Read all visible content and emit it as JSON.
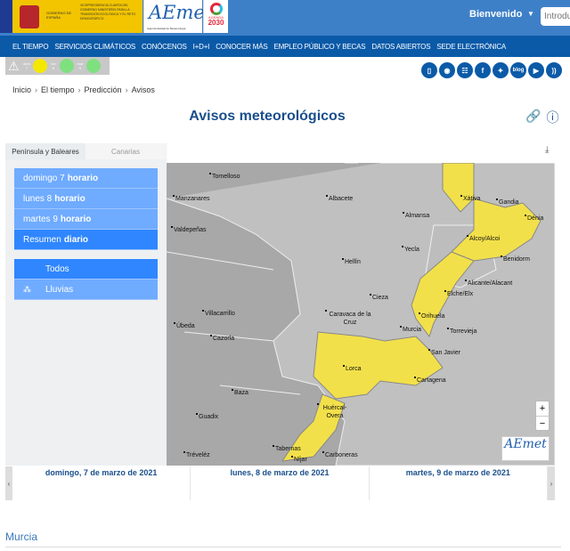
{
  "header": {
    "gov_label": "GOBIERNO DE ESPAÑA",
    "ministry": "VICEPRESIDENCIA CUARTA DEL GOBIERNO MINISTERIO PARA LA TRANSICIÓN ECOLÓGICA Y EL RETO DEMOGRÁFICO",
    "logo": "AEmet",
    "logo_sub": "Agencia Estatal de Meteorología",
    "agenda": "AGENDA",
    "agenda_year": "2030",
    "welcome": "Bienvenido",
    "search_placeholder": "Introdu"
  },
  "nav": [
    "EL TIEMPO",
    "SERVICIOS CLIMÁTICOS",
    "CONÓCENOS",
    "I+D+I",
    "CONOCER MÁS",
    "EMPLEO PÚBLICO Y BECAS",
    "DATOS ABIERTOS",
    "SEDE ELECTRÓNICA"
  ],
  "warnings": [
    {
      "day": "dom",
      "num": "7",
      "color": "#f5e800"
    },
    {
      "day": "lun",
      "num": "8",
      "color": "#7fe07f"
    },
    {
      "day": "mar",
      "num": "9",
      "color": "#7fe07f"
    }
  ],
  "social": [
    "mobile",
    "android",
    "sitemap",
    "facebook",
    "twitter",
    "blog",
    "youtube",
    "rss"
  ],
  "social_blog": "blog",
  "breadcrumb": [
    "Inicio",
    "El tiempo",
    "Predicción",
    "Avisos"
  ],
  "title": "Avisos meteorológicos",
  "tabs": [
    "Península y Baleares",
    "Canarias"
  ],
  "options": [
    {
      "a": "domingo 7",
      "b": "horario"
    },
    {
      "a": "lunes 8",
      "b": "horario"
    },
    {
      "a": "martes 9",
      "b": "horario"
    },
    {
      "a": "Resumen",
      "b": "diario"
    }
  ],
  "filters": [
    "Todos",
    "Lluvias"
  ],
  "map": {
    "warning_color": "#f2e04a",
    "cities": [
      "Tomelloso",
      "Manzanares",
      "Albacete",
      "Xàtiva",
      "Gandia",
      "Almansa",
      "Dénia",
      "Valdepeñas",
      "Alcoy/Alcoi",
      "Yecla",
      "Benidorm",
      "Hellín",
      "Alicante/Alacant",
      "Elche/Elx",
      "Cieza",
      "Villacarrillo",
      "Caravaca de la Cruz",
      "Orihuela",
      "Úbeda",
      "Torrevieja",
      "Murcia",
      "Cazorla",
      "San Javier",
      "Lorca",
      "Cartagena",
      "Baza",
      "Huércal-Overa",
      "Guadix",
      "Tabernas",
      "Carboneras",
      "Tréveléz",
      "Níjar"
    ],
    "logo": "AEmet"
  },
  "days": [
    "domingo, 7 de marzo de 2021",
    "lunes, 8 de marzo de 2021",
    "martes, 9 de marzo de 2021"
  ],
  "region": "Murcia"
}
